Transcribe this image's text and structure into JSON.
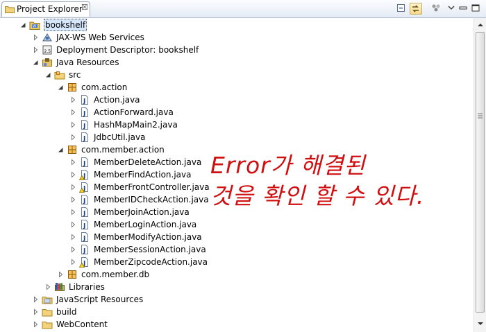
{
  "panel": {
    "tab_title": "Project Explorer",
    "tab_icon": "project-explorer-icon",
    "close_glyph": "☒",
    "toolbar": [
      "collapse-all-icon",
      "link-with-editor-icon",
      "view-menu-icon",
      "minimize-icon",
      "maximize-icon"
    ]
  },
  "tree": [
    {
      "label": "bookshelf",
      "depth": 0,
      "expanded": true,
      "icon": "project-icon",
      "selected": true
    },
    {
      "label": "JAX-WS Web Services",
      "depth": 1,
      "expanded": false,
      "icon": "web-services-icon"
    },
    {
      "label": "Deployment Descriptor: bookshelf",
      "depth": 1,
      "expanded": false,
      "icon": "deployment-descriptor-icon"
    },
    {
      "label": "Java Resources",
      "depth": 1,
      "expanded": true,
      "icon": "java-resources-icon"
    },
    {
      "label": "src",
      "depth": 2,
      "expanded": true,
      "icon": "source-folder-icon"
    },
    {
      "label": "com.action",
      "depth": 3,
      "expanded": true,
      "icon": "package-icon"
    },
    {
      "label": "Action.java",
      "depth": 4,
      "expanded": false,
      "icon": "java-file-icon"
    },
    {
      "label": "ActionForward.java",
      "depth": 4,
      "expanded": false,
      "icon": "java-file-icon"
    },
    {
      "label": "HashMapMain2.java",
      "depth": 4,
      "expanded": false,
      "icon": "java-file-icon"
    },
    {
      "label": "JdbcUtil.java",
      "depth": 4,
      "expanded": false,
      "icon": "java-file-icon"
    },
    {
      "label": "com.member.action",
      "depth": 3,
      "expanded": true,
      "icon": "package-icon"
    },
    {
      "label": "MemberDeleteAction.java",
      "depth": 4,
      "expanded": false,
      "icon": "java-file-icon"
    },
    {
      "label": "MemberFindAction.java",
      "depth": 4,
      "expanded": false,
      "icon": "java-file-warning-icon"
    },
    {
      "label": "MemberFrontController.java",
      "depth": 4,
      "expanded": false,
      "icon": "java-file-warning-icon"
    },
    {
      "label": "MemberIDCheckAction.java",
      "depth": 4,
      "expanded": false,
      "icon": "java-file-icon"
    },
    {
      "label": "MemberJoinAction.java",
      "depth": 4,
      "expanded": false,
      "icon": "java-file-icon"
    },
    {
      "label": "MemberLoginAction.java",
      "depth": 4,
      "expanded": false,
      "icon": "java-file-icon"
    },
    {
      "label": "MemberModifyAction.java",
      "depth": 4,
      "expanded": false,
      "icon": "java-file-icon"
    },
    {
      "label": "MemberSessionAction.java",
      "depth": 4,
      "expanded": false,
      "icon": "java-file-icon"
    },
    {
      "label": "MemberZipcodeAction.java",
      "depth": 4,
      "expanded": false,
      "icon": "java-file-warning-icon"
    },
    {
      "label": "com.member.db",
      "depth": 3,
      "expanded": false,
      "icon": "package-icon"
    },
    {
      "label": "Libraries",
      "depth": 2,
      "expanded": false,
      "icon": "libraries-icon"
    },
    {
      "label": "JavaScript Resources",
      "depth": 1,
      "expanded": false,
      "icon": "javascript-resources-icon"
    },
    {
      "label": "build",
      "depth": 1,
      "expanded": false,
      "icon": "folder-icon"
    },
    {
      "label": "WebContent",
      "depth": 1,
      "expanded": false,
      "icon": "folder-icon"
    }
  ],
  "annotation": {
    "line1": "Error가 해결된",
    "line2": "것을 확인 할 수 있다.",
    "color": "#d01010"
  }
}
